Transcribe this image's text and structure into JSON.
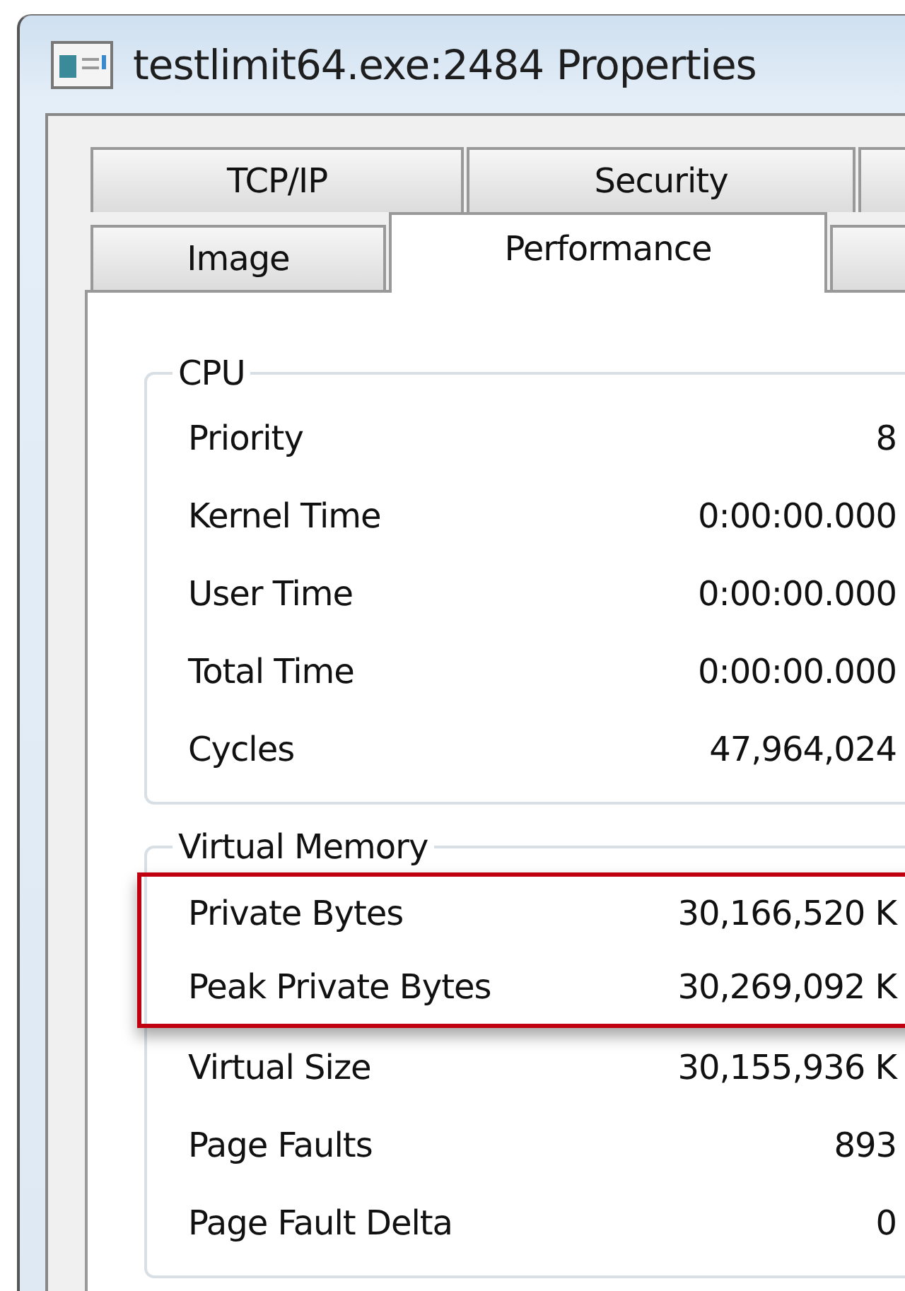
{
  "window": {
    "title": "testlimit64.exe:2484 Properties"
  },
  "tab_rows": [
    [
      {
        "label": "TCP/IP",
        "selected": false
      },
      {
        "label": "Security",
        "selected": false
      }
    ],
    [
      {
        "label": "Image",
        "selected": false
      },
      {
        "label": "Performance",
        "selected": true
      }
    ]
  ],
  "groups": [
    {
      "title": "CPU",
      "rows": [
        {
          "label": "Priority",
          "value": "8",
          "highlighted": false
        },
        {
          "label": "Kernel Time",
          "value": "0:00:00.000",
          "highlighted": false
        },
        {
          "label": "User Time",
          "value": "0:00:00.000",
          "highlighted": false
        },
        {
          "label": "Total Time",
          "value": "0:00:00.000",
          "highlighted": false
        },
        {
          "label": "Cycles",
          "value": "47,964,024",
          "highlighted": false
        }
      ]
    },
    {
      "title": "Virtual Memory",
      "rows": [
        {
          "label": "Private Bytes",
          "value": "30,166,520 K",
          "highlighted": true
        },
        {
          "label": "Peak Private Bytes",
          "value": "30,269,092 K",
          "highlighted": true
        },
        {
          "label": "Virtual Size",
          "value": "30,155,936 K",
          "highlighted": false
        },
        {
          "label": "Page Faults",
          "value": "893",
          "highlighted": false
        },
        {
          "label": "Page Fault Delta",
          "value": "0",
          "highlighted": false
        }
      ]
    }
  ]
}
